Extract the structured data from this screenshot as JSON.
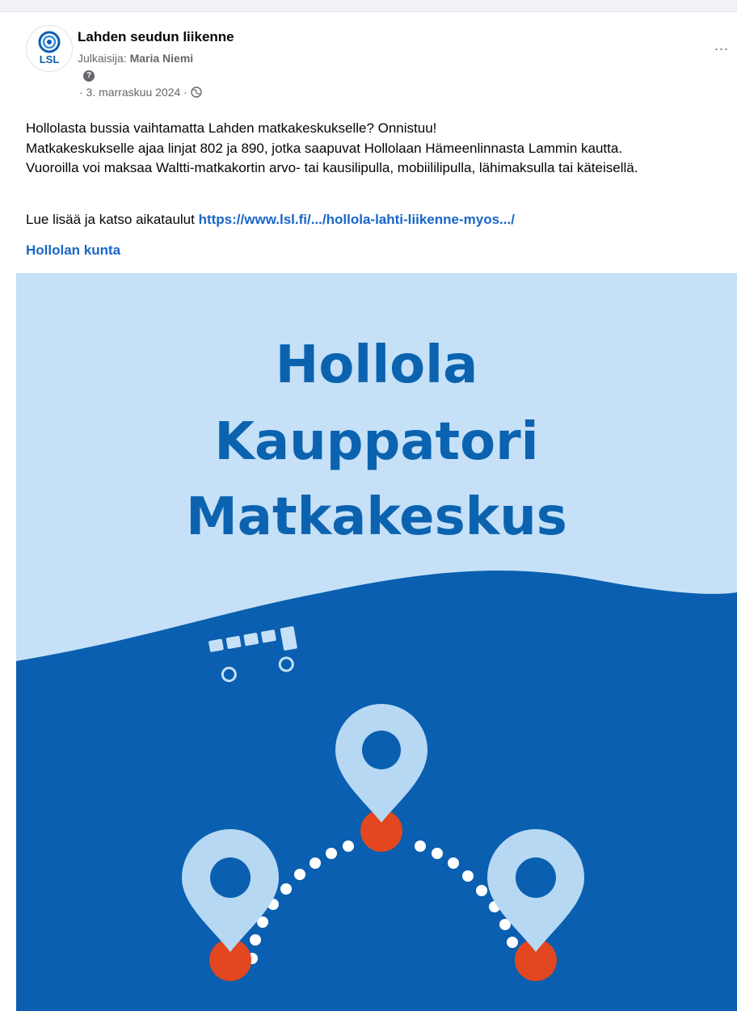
{
  "post": {
    "page_name": "Lahden seudun liikenne",
    "publisher_label": "Julkaisija:",
    "publisher_name": "Maria Niemi",
    "question_mark": "?",
    "date": "· 3. marraskuu 2024 ·",
    "more_label": "...",
    "logo_text": "LSL",
    "body_lines": [
      "Hollolasta bussia vaihtamatta Lahden matkakeskukselle? Onnistuu!",
      "Matkakeskukselle ajaa linjat 802 ja 890, jotka saapuvat Hollolaan Hämeenlinnasta Lammin kautta.",
      "Vuoroilla voi maksaa Waltti-matkakortin arvo- tai kausilipulla, mobiililipulla, lähimaksulla tai käteisellä."
    ],
    "read_more_prefix": "Lue lisää ja katso aikataulut",
    "link_text": "https://www.lsl.fi/.../hollola-lahti-liikenne-myos.../",
    "tag": "Hollolan kunta"
  },
  "image": {
    "title_lines": [
      "Hollola",
      "Kauppatori",
      "Matkakeskus"
    ],
    "colors": {
      "sky": "#c5e0f7",
      "dark_blue": "#0a5fb0",
      "title_blue": "#0b63b0",
      "pin_light": "#b6d8f3",
      "pin_dot": "#e2471f"
    }
  }
}
